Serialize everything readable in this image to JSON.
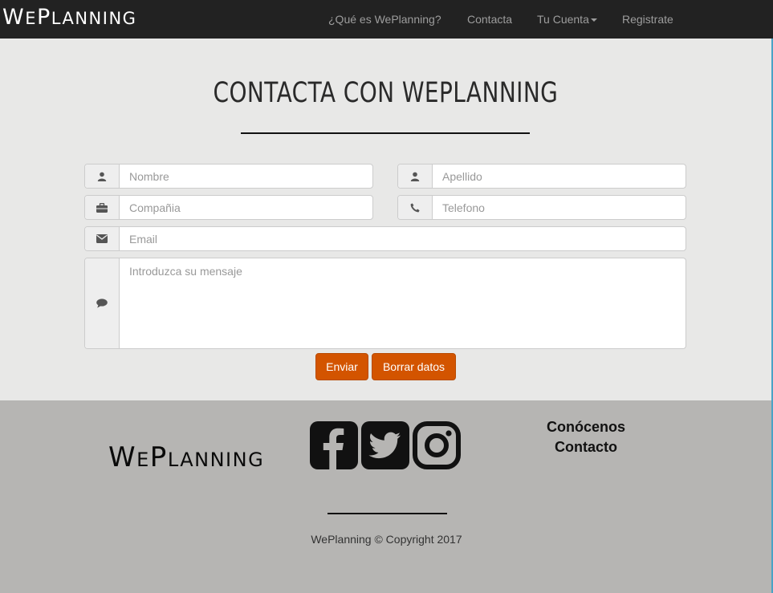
{
  "nav": {
    "brand": {
      "first": "W",
      "rest1": "E",
      "mid": "P",
      "rest2": "LANNING"
    },
    "items": [
      {
        "label": "¿Qué es WePlanning?"
      },
      {
        "label": "Contacta"
      },
      {
        "label": "Tu Cuenta"
      },
      {
        "label": "Registrate"
      }
    ]
  },
  "contact": {
    "title": "CONTACTA CON WEPLANNING",
    "fields": {
      "nombre": {
        "placeholder": "Nombre",
        "icon": "user-icon"
      },
      "apellido": {
        "placeholder": "Apellido",
        "icon": "user-icon"
      },
      "compania": {
        "placeholder": "Compañia",
        "icon": "briefcase-icon"
      },
      "telefono": {
        "placeholder": "Telefono",
        "icon": "phone-icon"
      },
      "email": {
        "placeholder": "Email",
        "icon": "envelope-icon"
      },
      "mensaje": {
        "placeholder": "Introduzca su mensaje",
        "icon": "comment-icon"
      }
    },
    "buttons": {
      "send": "Enviar",
      "clear": "Borrar datos"
    },
    "accent": "#d35400"
  },
  "footer": {
    "logo": {
      "first": "W",
      "rest1": "E",
      "mid": "P",
      "rest2": "LANNING"
    },
    "social": [
      "facebook-icon",
      "twitter-icon",
      "instagram-icon"
    ],
    "links": [
      "Conócenos",
      "Contacto"
    ],
    "copyright": "WePlanning © Copyright 2017"
  }
}
